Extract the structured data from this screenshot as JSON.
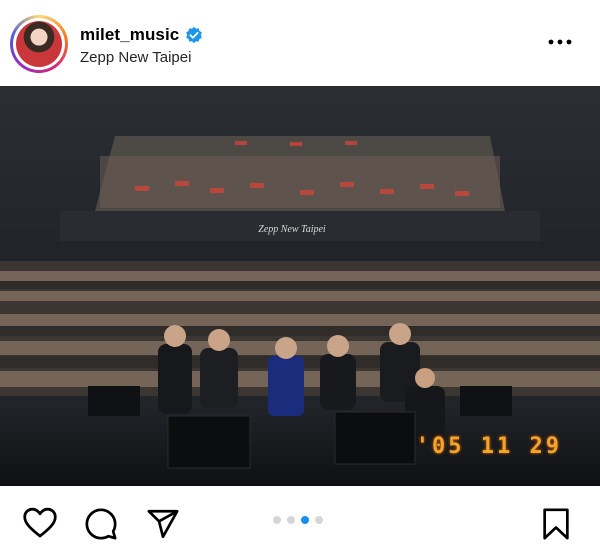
{
  "post": {
    "username": "milet_music",
    "location": "Zepp New Taipei",
    "verified": true
  },
  "photo": {
    "venue_sign": "Zepp New Taipei",
    "date_stamp": "'05 11 29"
  },
  "carousel": {
    "total": 4,
    "active_index": 2
  },
  "icons": {
    "verified": "verified-badge-icon",
    "more": "more-options-icon",
    "like": "heart-icon",
    "comment": "comment-icon",
    "share": "send-icon",
    "save": "bookmark-icon"
  },
  "colors": {
    "verified": "#1c96e8",
    "carousel_active": "#1c8cf0",
    "carousel_inactive": "#d6d6d6",
    "date_stamp": "#f3a52a"
  }
}
